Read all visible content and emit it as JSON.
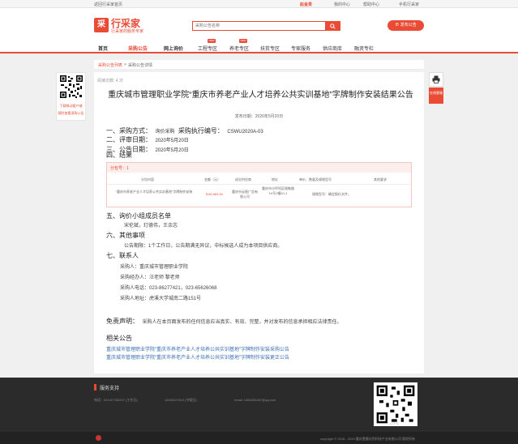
{
  "topbar": {
    "home_link": "返回行采家首页",
    "city": "赵金贵",
    "my_center": "我的中心",
    "help_center": "帮助中心",
    "mobile": "手机行采家"
  },
  "header": {
    "logo_mark": "采",
    "logo_text": "行采家",
    "slogan": "行采家的服务专家",
    "search_placeholder": "采购公告名称",
    "publish_label": "发布公告"
  },
  "nav": {
    "items": [
      {
        "label": "首页"
      },
      {
        "label": "采购公告"
      },
      {
        "label": "网上询价"
      },
      {
        "label": "工程专区"
      },
      {
        "label": "养老专区"
      },
      {
        "label": "扶贫专区"
      },
      {
        "label": "专家服务"
      },
      {
        "label": "供应商库"
      },
      {
        "label": "融资专栏"
      }
    ],
    "new_badge": "NEW"
  },
  "breadcrumb": {
    "a": "采购公告列表",
    "sep": ">",
    "b": "采购公告详情"
  },
  "sidebar_left": {
    "caption1": "下载移动客户端",
    "caption2": "随时查看采购公告"
  },
  "sidebar_right": {
    "tool2": "在线客服"
  },
  "article": {
    "views": "阅读次数: 4 次",
    "title": "重庆城市管理职业学院“重庆市养老产业人才培养公共实训基地”字牌制作安装结果公告",
    "pubdate": "发布日期：2020年5月20日",
    "s1_label": "一、采购方式：",
    "s1_value": "询价采购",
    "s1_label2": "采购执行编号：",
    "s1_value2": "CSWU2020A-03",
    "s2_label": "二、评审日期：",
    "s2_value": "2020年5月20日",
    "s3_label": "三、公告日期：",
    "s3_value": "2020年5月20日",
    "s4_label": "四、结果",
    "table": {
      "package": "分包号：1",
      "headers": [
        "分包内容",
        "金额（元）",
        "成交供应商",
        "地址",
        "单价、数量及规格型号",
        "其他要求"
      ],
      "row": {
        "content": "“重庆市养老产业人才培养公共实训基地”字牌制作安装",
        "amount": "￥66,983.00",
        "supplier": "重庆市云图广告有限公司",
        "address": "重庆市沙坪坝区格勒路19号1幢10-1",
        "spec": "规格型号：确定报价文件。",
        "other": ""
      }
    },
    "s5_label": "五、询价小组成员名单",
    "s5_value": "宋伦斌，玎德伟，王余志",
    "s6_label": "六、其他事项",
    "s6_value": "公告期限：1个工作日，公告期满无异议，中标候选人成为本项目供应商。",
    "s7_label": "七、联系人",
    "c1": "采购人：重庆城市管理职业学院",
    "c2": "采购经办人：汪老师 黎老师",
    "c3": "采购人电话：023-86277421，023-65626068",
    "c4": "采购人地址：虎溪大学城南二路151号",
    "disclaimer_label": "免责声明：",
    "disclaimer": "采购人在本页面发布的任何信息应当真实、有效、完整，并对发布的信息承担相应法律责任。",
    "related_title": "相关公告",
    "related": [
      "重庆城市管理职业学院“重庆市养老产业人才培养公共实训基地”字牌制作安装采购公告",
      "重庆城市管理职业学院“重庆市养老产业人才培养公共实训基地”字牌制作安装更正公告"
    ]
  },
  "footer": {
    "service_title": "服务支持",
    "phone1": "电话：023-67782237 (工作日)",
    "phone2": "18183107611 (节假日)",
    "email": "email: 1481894467@qq.com",
    "public_account": "公众号",
    "icp": "copyright © 2016 - 2019 重庆壹墨化贸科技产业有限公司 版权所有"
  },
  "colors": {
    "brand": "#e94b35",
    "link": "#3a6fb3"
  }
}
